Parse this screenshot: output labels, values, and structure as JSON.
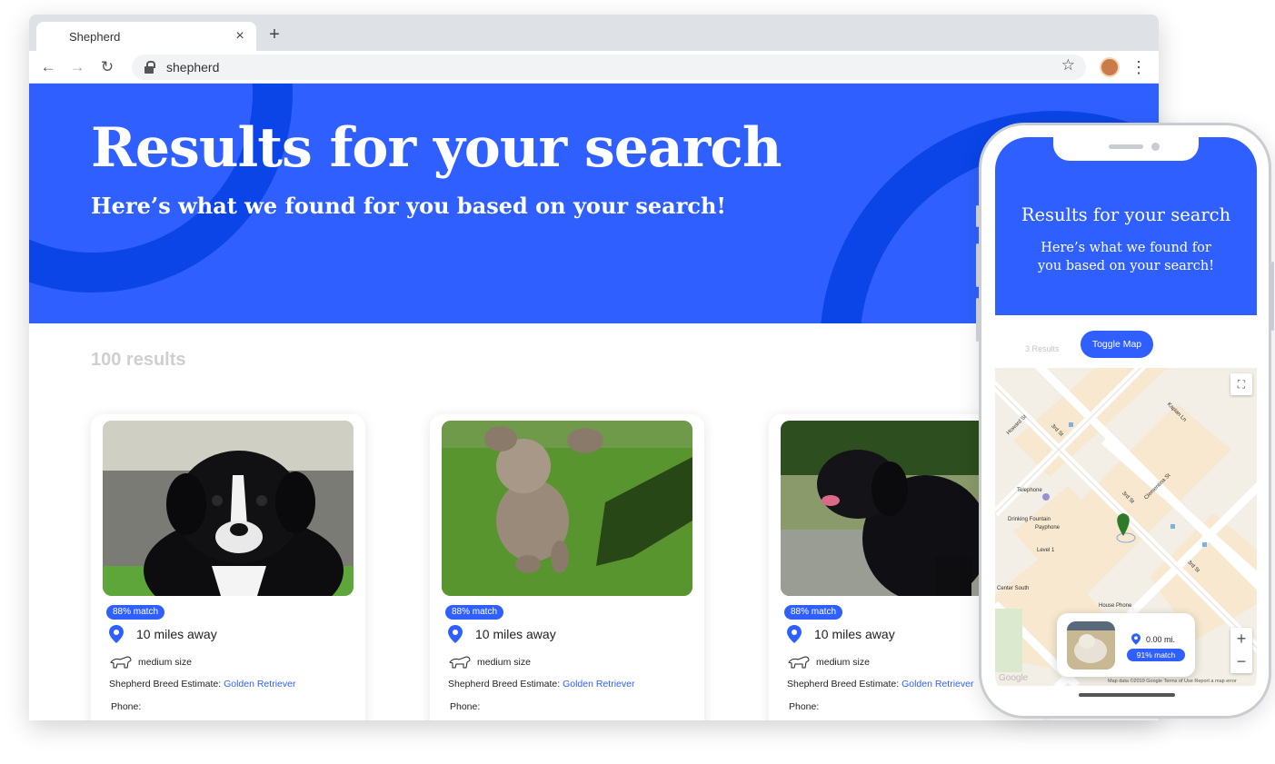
{
  "browser": {
    "tab_title": "Shepherd",
    "tab_close": "×",
    "new_tab": "+",
    "url": "shepherd"
  },
  "hero": {
    "title": "Results for your search",
    "subtitle": "Here’s what we found for you based on your search!"
  },
  "results": {
    "count_label": "100 results",
    "cards": [
      {
        "photo": "black-and-white-puppy",
        "match": "88% match",
        "distance": "10 miles away",
        "size": "medium size",
        "breed_label": "Shepherd Breed Estimate: ",
        "breed": "Golden Retriever",
        "phone_label": "Phone:"
      },
      {
        "photo": "fluffy-brown-dog-on-grass",
        "match": "88% match",
        "distance": "10 miles away",
        "size": "medium size",
        "breed_label": "Shepherd Breed Estimate: ",
        "breed": "Golden Retriever",
        "phone_label": "Phone:"
      },
      {
        "photo": "black-dog-sitting",
        "match": "88% match",
        "distance": "10 miles away",
        "size": "medium size",
        "breed_label": "Shepherd Breed Estimate: ",
        "breed": "Golden Retriever",
        "phone_label": "Phone:"
      }
    ]
  },
  "phone": {
    "title": "Results for your search",
    "subtitle": "Here’s what we found for you based on your search!",
    "count_label": "3 Results",
    "toggle_label": "Toggle Map",
    "map": {
      "labels": [
        "Howard St",
        "3rd St",
        "Kaplan Ln",
        "Clementina St",
        "Telephone",
        "Drinking Fountain",
        "Payphone",
        "Level 1",
        "3rd St",
        "Center South",
        "House Phone",
        "3rd St"
      ],
      "result": {
        "distance": "0.00 mi.",
        "match": "91% match"
      },
      "attribution": "Map data ©2019 Google   Terms of Use   Report a map error",
      "google": "Google"
    }
  },
  "colors": {
    "brand": "#2f60ff",
    "brand_dark": "#0b45e8"
  }
}
